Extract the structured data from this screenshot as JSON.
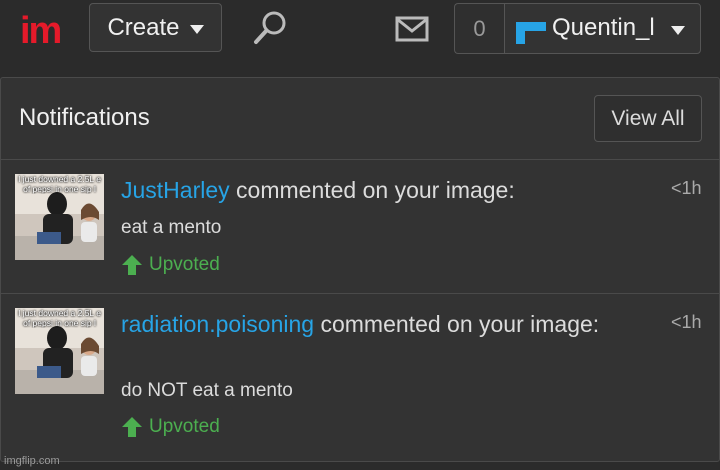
{
  "colors": {
    "background": "#2b2b2b",
    "panel": "#333333",
    "username": "#27a4e6",
    "upvote": "#4caf50",
    "logo_red": "#e51a2a"
  },
  "header": {
    "logo_text": "im",
    "create_label": "Create",
    "search_icon": "search-icon",
    "mail_icon": "envelope-icon",
    "notification_count": "0",
    "username": "Quentin_l"
  },
  "notifications_panel": {
    "title": "Notifications",
    "view_all_label": "View All",
    "items": [
      {
        "user": "JustHarley",
        "action": " commented on your image:",
        "time": "<1h",
        "comment": "eat a mento",
        "status": "Upvoted",
        "thumbnail_caption": "I just downed a 2.5L e of pepsi in one sip l"
      },
      {
        "user": "radiation.poisoning",
        "action": " commented on your image:",
        "time": "<1h",
        "comment": "do NOT eat a mento",
        "status": "Upvoted",
        "thumbnail_caption": "I just downed a 2.5L e of pepsi in one sip l"
      }
    ]
  },
  "footer": {
    "brand": "imgflip.com"
  }
}
